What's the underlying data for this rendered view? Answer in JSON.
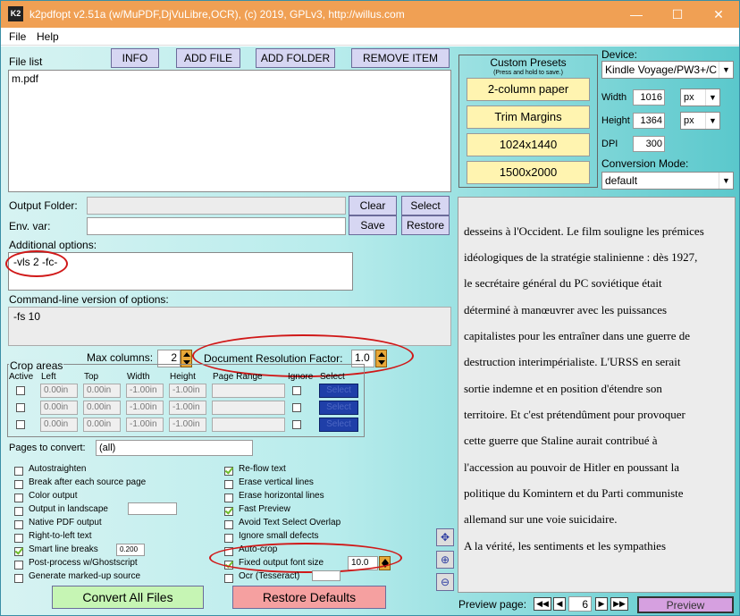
{
  "window": {
    "title": "k2pdfopt v2.51a (w/MuPDF,DjVuLibre,OCR), (c) 2019, GPLv3, http://willus.com",
    "icon_text": "K2"
  },
  "menu": [
    "File",
    "Help"
  ],
  "file_list": {
    "label": "File list",
    "buttons": [
      "INFO",
      "ADD FILE",
      "ADD FOLDER",
      "REMOVE ITEM"
    ],
    "items": [
      "m.pdf"
    ]
  },
  "output_folder": {
    "label": "Output Folder:",
    "value": "",
    "clear": "Clear",
    "select": "Select"
  },
  "env_var": {
    "label": "Env. var:",
    "value": "",
    "save": "Save",
    "restore": "Restore"
  },
  "additional_options": {
    "label": "Additional options:",
    "value": "-vls 2 -fc-"
  },
  "command_line": {
    "label": "Command-line version of options:",
    "value": "-fs 10"
  },
  "max_columns": {
    "label": "Max columns:",
    "value": "2"
  },
  "resolution": {
    "label": "Document Resolution Factor:",
    "value": "1.0"
  },
  "crop": {
    "title": "Crop areas",
    "headers": [
      "Active",
      "Left",
      "Top",
      "Width",
      "Height",
      "Page Range",
      "Ignore",
      "Select"
    ],
    "rows": [
      {
        "left": "0.00in",
        "top": "0.00in",
        "width": "-1.00in",
        "height": "-1.00in",
        "select": "Select"
      },
      {
        "left": "0.00in",
        "top": "0.00in",
        "width": "-1.00in",
        "height": "-1.00in",
        "select": "Select"
      },
      {
        "left": "0.00in",
        "top": "0.00in",
        "width": "-1.00in",
        "height": "-1.00in",
        "select": "Select"
      }
    ]
  },
  "pages": {
    "label": "Pages to convert:",
    "value": "(all)"
  },
  "options_left": [
    {
      "label": "Autostraighten",
      "checked": false
    },
    {
      "label": "Break after each source page",
      "checked": false
    },
    {
      "label": "Color output",
      "checked": false
    },
    {
      "label": "Output in landscape",
      "checked": false
    },
    {
      "label": "Native PDF output",
      "checked": false
    },
    {
      "label": "Right-to-left text",
      "checked": false
    },
    {
      "label": "Smart line breaks",
      "checked": true,
      "value": "0.200"
    },
    {
      "label": "Post-process w/Ghostscript",
      "checked": false
    },
    {
      "label": "Generate marked-up source",
      "checked": false
    }
  ],
  "options_right": [
    {
      "label": "Re-flow text",
      "checked": true
    },
    {
      "label": "Erase vertical lines",
      "checked": false
    },
    {
      "label": "Erase horizontal lines",
      "checked": false
    },
    {
      "label": "Fast Preview",
      "checked": true
    },
    {
      "label": "Avoid Text Select Overlap",
      "checked": false
    },
    {
      "label": "Ignore small defects",
      "checked": false
    },
    {
      "label": "Auto-crop",
      "checked": false
    },
    {
      "label": "Fixed output font size",
      "checked": true,
      "value": "10.0"
    },
    {
      "label": "Ocr (Tesseract)",
      "checked": false
    }
  ],
  "actions": {
    "convert": "Convert All Files",
    "restore_defaults": "Restore Defaults"
  },
  "presets": {
    "title": "Custom Presets",
    "subtitle": "(Press and hold to save.)",
    "buttons": [
      "2-column paper",
      "Trim Margins",
      "1024x1440",
      "1500x2000"
    ]
  },
  "device": {
    "label": "Device:",
    "value": "Kindle Voyage/PW3+/C",
    "width_label": "Width",
    "width": "1016",
    "width_unit": "px",
    "height_label": "Height",
    "height": "1364",
    "height_unit": "px",
    "dpi_label": "DPI",
    "dpi": "300",
    "mode_label": "Conversion Mode:",
    "mode": "default"
  },
  "preview": {
    "lines": [
      "desseins à l'Occident. Le film souligne les prémices",
      "idéologiques de la stratégie stalinienne : dès 1927,",
      "le secrétaire général du PC soviétique était",
      "déterminé à manœuvrer avec les puissances",
      "capitalistes pour les entraîner dans une guerre de",
      "destruction interimpérialiste. L'URSS en serait",
      "sortie indemne et en position d'étendre son",
      "territoire. Et c'est prétendûment pour provoquer",
      "cette guerre que Staline aurait contribué à",
      "l'accession au pouvoir de Hitler en poussant la",
      "politique du Komintern et du Parti communiste",
      "allemand sur une voie suicidaire.",
      "A la vérité, les sentiments et les sympathies"
    ],
    "page_label": "Preview page:",
    "page": "6",
    "button": "Preview"
  },
  "colors": {
    "titlebar": "#f0a054",
    "annotation": "#d01818",
    "select_blue": "#1f3fa8"
  }
}
